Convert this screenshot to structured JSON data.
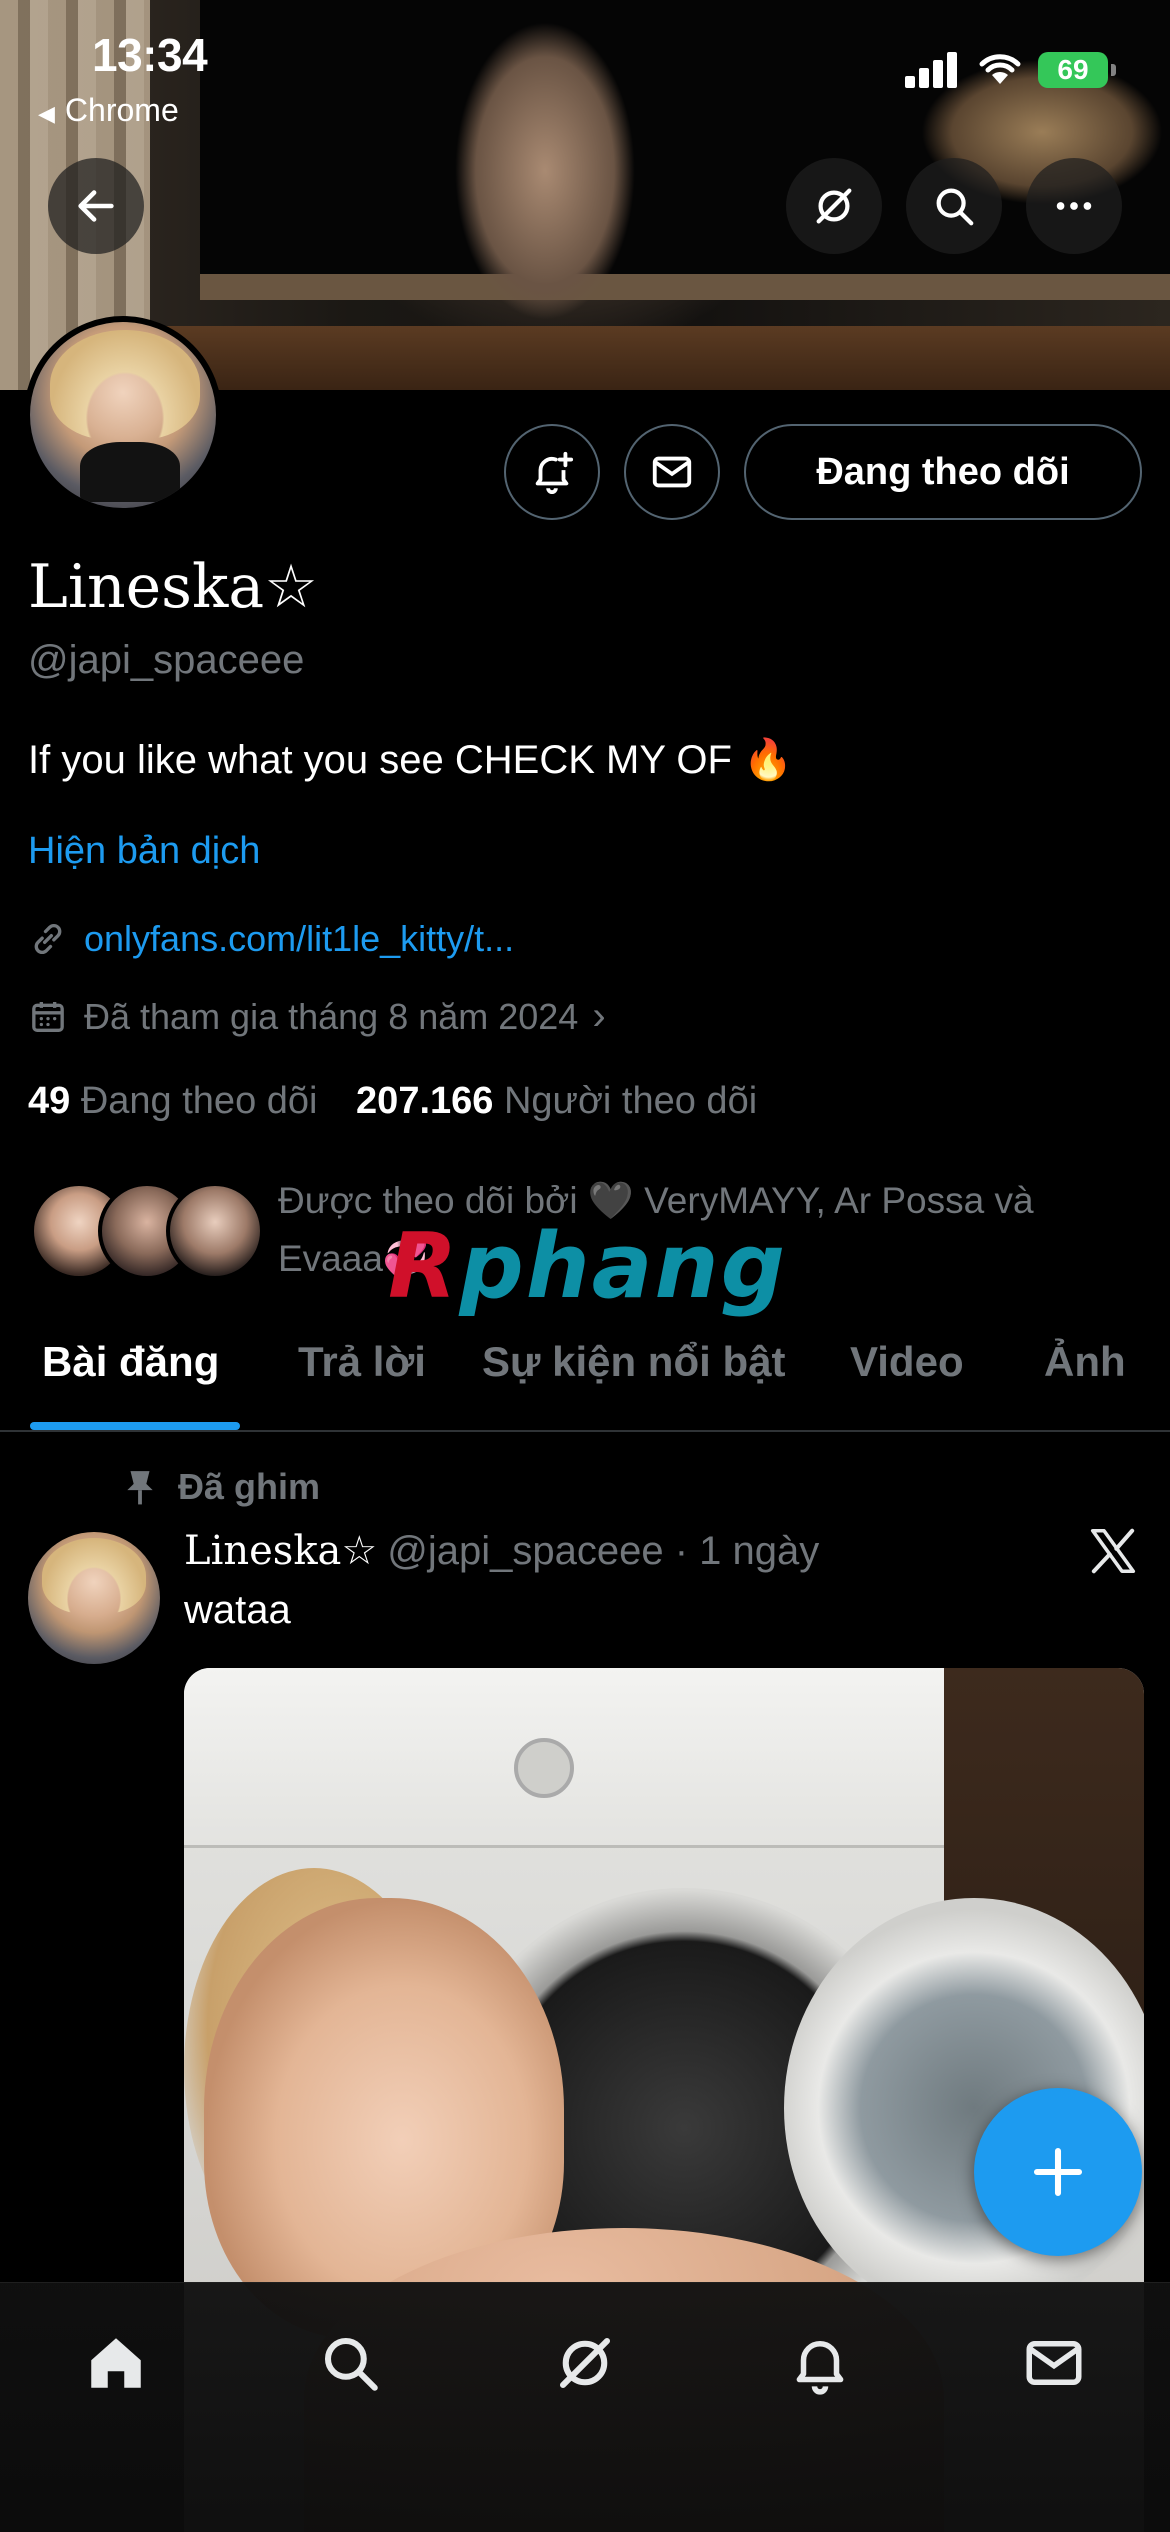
{
  "status_bar": {
    "time": "13:34",
    "back_app": "Chrome",
    "battery": "69"
  },
  "header_icons": {
    "back": "back-arrow-icon",
    "grok": "grok-icon",
    "search": "search-icon",
    "more": "more-icon"
  },
  "profile": {
    "name": "Lineska☆",
    "handle": "@japi_spaceee",
    "bio": "If you like what you see CHECK MY OF 🔥",
    "translate": "Hiện bản dịch",
    "link": "onlyfans.com/lit1le_kitty/t...",
    "joined": "Đã tham gia tháng 8 năm 2024",
    "following_count": "49",
    "following_label": "Đang theo dõi",
    "followers_count": "207.166",
    "followers_label": "Người theo dõi",
    "followed_by": "Được theo dõi bởi 🖤 VeryMAYY, Ar Possa và Evaaa💞"
  },
  "actions": {
    "follow_label": "Đang theo dõi",
    "notify_icon": "bell-plus-icon",
    "message_icon": "mail-icon"
  },
  "watermark": {
    "first": "R",
    "rest": "phang"
  },
  "tabs": [
    {
      "label": "Bài đăng",
      "active": true
    },
    {
      "label": "Trả lời",
      "active": false
    },
    {
      "label": "Sự kiện nổi bật",
      "active": false
    },
    {
      "label": "Video",
      "active": false
    },
    {
      "label": "Ảnh",
      "active": false
    }
  ],
  "post": {
    "pinned_label": "Đã ghim",
    "author_name": "Lineska☆",
    "author_handle": "@japi_spaceee",
    "time": "· 1 ngày",
    "text": "wataa"
  },
  "bottom_nav": [
    "home-icon",
    "search-icon",
    "grok-icon",
    "notifications-icon",
    "messages-icon"
  ],
  "colors": {
    "accent": "#1d9bf0",
    "background": "#000000",
    "muted": "#71767b"
  }
}
